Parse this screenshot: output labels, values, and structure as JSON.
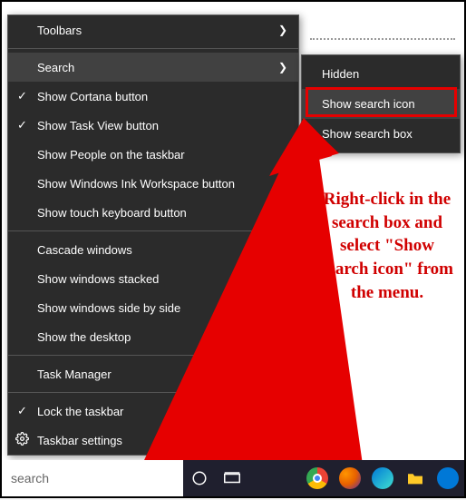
{
  "context_menu": {
    "items": [
      {
        "label": "Toolbars",
        "submenu": true
      },
      {
        "separator": true
      },
      {
        "label": "Search",
        "submenu": true,
        "highlighted": true
      },
      {
        "label": "Show Cortana button",
        "checked": true
      },
      {
        "label": "Show Task View button",
        "checked": true
      },
      {
        "label": "Show People on the taskbar"
      },
      {
        "label": "Show Windows Ink Workspace button"
      },
      {
        "label": "Show touch keyboard button"
      },
      {
        "separator": true
      },
      {
        "label": "Cascade windows"
      },
      {
        "label": "Show windows stacked"
      },
      {
        "label": "Show windows side by side"
      },
      {
        "label": "Show the desktop"
      },
      {
        "separator": true
      },
      {
        "label": "Task Manager"
      },
      {
        "separator": true
      },
      {
        "label": "Lock the taskbar",
        "checked": true
      },
      {
        "label": "Taskbar settings",
        "icon": "gear"
      }
    ]
  },
  "submenu": {
    "items": [
      {
        "label": "Hidden"
      },
      {
        "label": "Show search icon",
        "boxed": true
      },
      {
        "label": "Show search box"
      }
    ]
  },
  "instruction_text": "Right-click in the search box and select \"Show search icon\" from the menu.",
  "taskbar": {
    "search_placeholder": "search"
  },
  "colors": {
    "menu_bg": "#2b2b2b",
    "menu_hover": "#414141",
    "highlight_red": "#e60000",
    "text_red": "#d00000",
    "taskbar_bg": "#1f1f2e"
  }
}
